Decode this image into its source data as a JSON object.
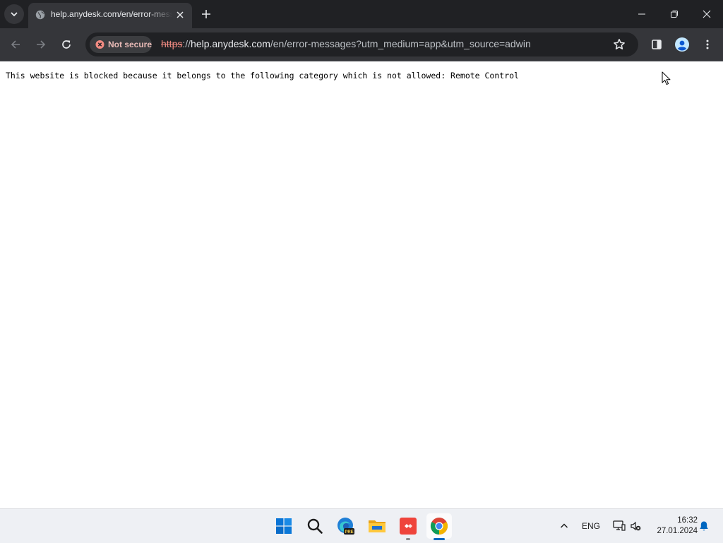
{
  "browser": {
    "tab": {
      "title": "help.anydesk.com/en/error-messages"
    },
    "omnibox": {
      "security_label": "Not secure",
      "url_scheme": "https",
      "url_sep": "://",
      "url_host": "help.anydesk.com",
      "url_rest": "/en/error-messages?utm_medium=app&utm_source=adwin"
    }
  },
  "page": {
    "message": "This website is blocked because it belongs to the following category which is not allowed: Remote Control"
  },
  "taskbar": {
    "apps": [
      "start",
      "search",
      "edge-pre",
      "file-explorer",
      "anydesk",
      "chrome"
    ],
    "edge_badge": "PRE",
    "tray": {
      "language": "ENG",
      "time": "16:32",
      "date": "27.01.2024"
    }
  },
  "colors": {
    "titlebar": "#202124",
    "toolbar": "#35363a",
    "not_secure": "#f28b82",
    "taskbar": "#eef0f4",
    "anydesk": "#ef443b",
    "win_accent": "#0067c0"
  }
}
